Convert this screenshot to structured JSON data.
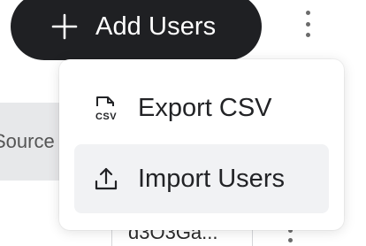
{
  "header": {
    "add_users_label": "Add Users",
    "plus_icon": "plus-icon",
    "kebab_icon": "kebab-vertical-icon"
  },
  "background": {
    "source_chip_text": "Source",
    "cell_fragment_text": "d3O3Ga..."
  },
  "dropdown": {
    "items": [
      {
        "label": "Export CSV",
        "icon": "csv-file-icon"
      },
      {
        "label": "Import Users",
        "icon": "upload-icon"
      }
    ]
  },
  "colors": {
    "primary_dark": "#1f2023",
    "menu_hover": "#f1f2f4",
    "chip_bg": "#e7e8ea"
  }
}
